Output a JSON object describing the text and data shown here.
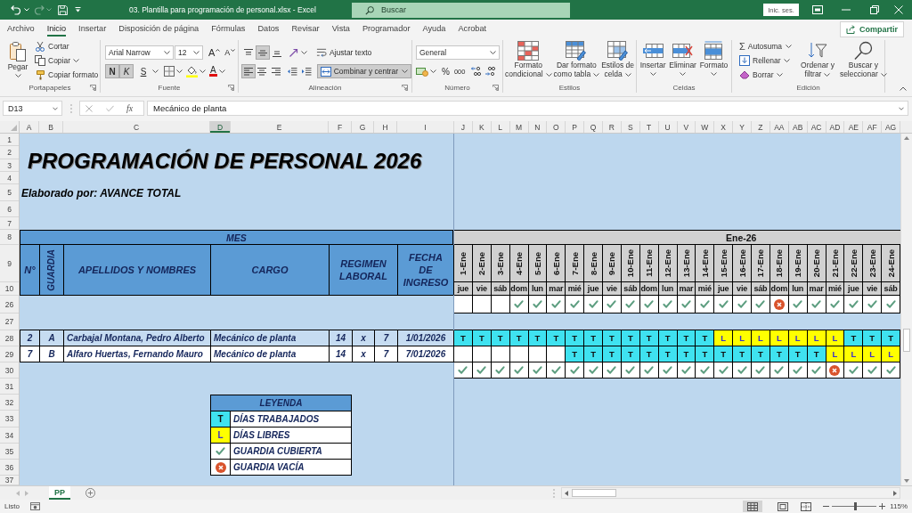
{
  "title_bar": {
    "quick_access": {
      "redo_disabled": true
    },
    "title": "03. Plantilla para programación de personal.xlsx - Excel",
    "search": {
      "placeholder": "Buscar"
    },
    "sign_in": "Inic. ses."
  },
  "ribbon_tabs": [
    {
      "label": "Archivo",
      "selected": false
    },
    {
      "label": "Inicio",
      "selected": true
    },
    {
      "label": "Insertar",
      "selected": false
    },
    {
      "label": "Disposición de página",
      "selected": false
    },
    {
      "label": "Fórmulas",
      "selected": false
    },
    {
      "label": "Datos",
      "selected": false
    },
    {
      "label": "Revisar",
      "selected": false
    },
    {
      "label": "Vista",
      "selected": false
    },
    {
      "label": "Programador",
      "selected": false
    },
    {
      "label": "Ayuda",
      "selected": false
    },
    {
      "label": "Acrobat",
      "selected": false
    }
  ],
  "share_button": "Compartir",
  "clipboard": {
    "paste": "Pegar",
    "cut": "Cortar",
    "copy": "Copiar",
    "format_painter": "Copiar formato",
    "label": "Portapapeles"
  },
  "font": {
    "name": "Arial Narrow",
    "size": "12",
    "grow": "A",
    "shrink": "A",
    "styles": [
      {
        "kind": "bold",
        "label": "N",
        "on": true
      },
      {
        "kind": "italic",
        "label": "K",
        "on": true
      },
      {
        "kind": "underline",
        "label": "S",
        "on": false
      }
    ],
    "color_letter": "A",
    "label": "Fuente"
  },
  "alignment": {
    "vertical": [
      {
        "kind": "top",
        "on": false
      },
      {
        "kind": "middle",
        "on": true
      },
      {
        "kind": "bottom",
        "on": false
      }
    ],
    "wrap_text": {
      "label": "Ajustar texto",
      "on": false
    },
    "horizontal": [
      {
        "kind": "left",
        "on": true
      },
      {
        "kind": "center",
        "on": false
      },
      {
        "kind": "right",
        "on": false
      }
    ],
    "merge": {
      "label": "Combinar y centrar",
      "on": true
    },
    "label": "Alineación"
  },
  "number": {
    "format": "General",
    "percent": "%",
    "thousands": "000",
    "label": "Número"
  },
  "styles": {
    "buttons": [
      {
        "kind": "conditional",
        "label": "Formato\ncondicional"
      },
      {
        "kind": "table",
        "label": "Dar formato\ncomo tabla"
      },
      {
        "kind": "cell_styles",
        "label": "Estilos de\ncelda"
      }
    ],
    "label": "Estilos"
  },
  "cells": {
    "buttons": [
      {
        "kind": "insert",
        "label": "Insertar"
      },
      {
        "kind": "delete",
        "label": "Eliminar"
      },
      {
        "kind": "format",
        "label": "Formato"
      }
    ],
    "label": "Celdas"
  },
  "editing": {
    "autosum_symbol": "Σ",
    "autosum": "Autosuma",
    "fill": "Rellenar",
    "clear": "Borrar",
    "sort": "Ordenar y\nfiltrar",
    "find": "Buscar y\nseleccionar",
    "label": "Edición"
  },
  "formula_bar": {
    "name_box": "D13",
    "function_button": "fx",
    "value": "Mecánico de planta"
  },
  "columns": [
    {
      "label": "A",
      "selected": false
    },
    {
      "label": "B",
      "selected": false
    },
    {
      "label": "C",
      "selected": false
    },
    {
      "label": "D",
      "selected": true
    },
    {
      "label": "E",
      "selected": false
    },
    {
      "label": "F",
      "selected": false
    },
    {
      "label": "G",
      "selected": false
    },
    {
      "label": "H",
      "selected": false
    },
    {
      "label": "I",
      "selected": false
    },
    {
      "label": "J",
      "selected": false
    },
    {
      "label": "K",
      "selected": false
    },
    {
      "label": "L",
      "selected": false
    },
    {
      "label": "M",
      "selected": false
    },
    {
      "label": "N",
      "selected": false
    },
    {
      "label": "O",
      "selected": false
    },
    {
      "label": "P",
      "selected": false
    },
    {
      "label": "Q",
      "selected": false
    },
    {
      "label": "R",
      "selected": false
    },
    {
      "label": "S",
      "selected": false
    },
    {
      "label": "T",
      "selected": false
    },
    {
      "label": "U",
      "selected": false
    },
    {
      "label": "V",
      "selected": false
    },
    {
      "label": "W",
      "selected": false
    },
    {
      "label": "X",
      "selected": false
    },
    {
      "label": "Y",
      "selected": false
    },
    {
      "label": "Z",
      "selected": false
    },
    {
      "label": "AA",
      "selected": false
    },
    {
      "label": "AB",
      "selected": false
    },
    {
      "label": "AC",
      "selected": false
    },
    {
      "label": "AD",
      "selected": false
    },
    {
      "label": "AE",
      "selected": false
    },
    {
      "label": "AF",
      "selected": false
    },
    {
      "label": "AG",
      "selected": false
    }
  ],
  "row_numbers": [
    "1",
    "2",
    "3",
    "4",
    "5",
    "6",
    "7",
    "8",
    "9",
    "10",
    "26",
    "27",
    "28",
    "29",
    "30",
    "31",
    "32",
    "33",
    "34",
    "35",
    "36",
    "37"
  ],
  "sheet": {
    "title": "PROGRAMACIÓN DE PERSONAL 2026",
    "subtitle": "Elaborado por: AVANCE TOTAL",
    "month_header": "MES",
    "period_header": "Ene-26",
    "headers": [
      {
        "kind": "number",
        "label": "N°"
      },
      {
        "kind": "guard",
        "label": "GUARDIA"
      },
      {
        "kind": "name",
        "label": "APELLIDOS Y NOMBRES"
      },
      {
        "kind": "position",
        "label": "CARGO"
      },
      {
        "kind": "regime",
        "label": "REGIMEN LABORAL"
      },
      {
        "kind": "start_date",
        "label": "FECHA DE INGRESO"
      }
    ],
    "days": [
      {
        "date": "1-Ene",
        "weekday": "jue"
      },
      {
        "date": "2-Ene",
        "weekday": "vie"
      },
      {
        "date": "3-Ene",
        "weekday": "sáb"
      },
      {
        "date": "4-Ene",
        "weekday": "dom"
      },
      {
        "date": "5-Ene",
        "weekday": "lun"
      },
      {
        "date": "6-Ene",
        "weekday": "mar"
      },
      {
        "date": "7-Ene",
        "weekday": "mié"
      },
      {
        "date": "8-Ene",
        "weekday": "jue"
      },
      {
        "date": "9-Ene",
        "weekday": "vie"
      },
      {
        "date": "10-Ene",
        "weekday": "sáb"
      },
      {
        "date": "11-Ene",
        "weekday": "dom"
      },
      {
        "date": "12-Ene",
        "weekday": "lun"
      },
      {
        "date": "13-Ene",
        "weekday": "mar"
      },
      {
        "date": "14-Ene",
        "weekday": "mié"
      },
      {
        "date": "15-Ene",
        "weekday": "jue"
      },
      {
        "date": "16-Ene",
        "weekday": "vie"
      },
      {
        "date": "17-Ene",
        "weekday": "sáb"
      },
      {
        "date": "18-Ene",
        "weekday": "dom"
      },
      {
        "date": "19-Ene",
        "weekday": "lun"
      },
      {
        "date": "20-Ene",
        "weekday": "mar"
      },
      {
        "date": "21-Ene",
        "weekday": "mié"
      },
      {
        "date": "22-Ene",
        "weekday": "jue"
      },
      {
        "date": "23-Ene",
        "weekday": "vie"
      },
      {
        "date": "24-Ene",
        "weekday": "sáb"
      }
    ],
    "coverage_upper": [
      {
        "kind": "none"
      },
      {
        "kind": "none"
      },
      {
        "kind": "none"
      },
      {
        "kind": "covered"
      },
      {
        "kind": "covered"
      },
      {
        "kind": "covered"
      },
      {
        "kind": "covered"
      },
      {
        "kind": "covered"
      },
      {
        "kind": "covered"
      },
      {
        "kind": "covered"
      },
      {
        "kind": "covered"
      },
      {
        "kind": "covered"
      },
      {
        "kind": "covered"
      },
      {
        "kind": "covered"
      },
      {
        "kind": "covered"
      },
      {
        "kind": "covered"
      },
      {
        "kind": "covered"
      },
      {
        "kind": "vacant"
      },
      {
        "kind": "covered"
      },
      {
        "kind": "covered"
      },
      {
        "kind": "covered"
      },
      {
        "kind": "covered"
      },
      {
        "kind": "covered"
      },
      {
        "kind": "covered"
      }
    ],
    "staff": [
      {
        "number": "2",
        "guard": "A",
        "name": "Carbajal Montana, Pedro Alberto",
        "position": "Mecánico de planta",
        "days_on": "14",
        "regime_separator": "x",
        "days_off": "7",
        "start_date": "1/01/2026",
        "color": "#c6dcf1",
        "shifts": [
          {
            "kind": "worked",
            "code": "T"
          },
          {
            "kind": "worked",
            "code": "T"
          },
          {
            "kind": "worked",
            "code": "T"
          },
          {
            "kind": "worked",
            "code": "T"
          },
          {
            "kind": "worked",
            "code": "T"
          },
          {
            "kind": "worked",
            "code": "T"
          },
          {
            "kind": "worked",
            "code": "T"
          },
          {
            "kind": "worked",
            "code": "T"
          },
          {
            "kind": "worked",
            "code": "T"
          },
          {
            "kind": "worked",
            "code": "T"
          },
          {
            "kind": "worked",
            "code": "T"
          },
          {
            "kind": "worked",
            "code": "T"
          },
          {
            "kind": "worked",
            "code": "T"
          },
          {
            "kind": "worked",
            "code": "T"
          },
          {
            "kind": "rest",
            "code": "L"
          },
          {
            "kind": "rest",
            "code": "L"
          },
          {
            "kind": "rest",
            "code": "L"
          },
          {
            "kind": "rest",
            "code": "L"
          },
          {
            "kind": "rest",
            "code": "L"
          },
          {
            "kind": "rest",
            "code": "L"
          },
          {
            "kind": "rest",
            "code": "L"
          },
          {
            "kind": "worked",
            "code": "T"
          },
          {
            "kind": "worked",
            "code": "T"
          },
          {
            "kind": "worked",
            "code": "T"
          }
        ]
      },
      {
        "number": "7",
        "guard": "B",
        "name": "Alfaro Huertas, Fernando Mauro",
        "position": "Mecánico de planta",
        "days_on": "14",
        "regime_separator": "x",
        "days_off": "7",
        "start_date": "7/01/2026",
        "color": "#ffffff",
        "shifts": [
          {
            "kind": "none"
          },
          {
            "kind": "none"
          },
          {
            "kind": "none"
          },
          {
            "kind": "none"
          },
          {
            "kind": "none"
          },
          {
            "kind": "none"
          },
          {
            "kind": "worked",
            "code": "T"
          },
          {
            "kind": "worked",
            "code": "T"
          },
          {
            "kind": "worked",
            "code": "T"
          },
          {
            "kind": "worked",
            "code": "T"
          },
          {
            "kind": "worked",
            "code": "T"
          },
          {
            "kind": "worked",
            "code": "T"
          },
          {
            "kind": "worked",
            "code": "T"
          },
          {
            "kind": "worked",
            "code": "T"
          },
          {
            "kind": "worked",
            "code": "T"
          },
          {
            "kind": "worked",
            "code": "T"
          },
          {
            "kind": "worked",
            "code": "T"
          },
          {
            "kind": "worked",
            "code": "T"
          },
          {
            "kind": "worked",
            "code": "T"
          },
          {
            "kind": "worked",
            "code": "T"
          },
          {
            "kind": "rest",
            "code": "L"
          },
          {
            "kind": "rest",
            "code": "L"
          },
          {
            "kind": "rest",
            "code": "L"
          },
          {
            "kind": "rest",
            "code": "L"
          }
        ]
      }
    ],
    "coverage_lower": [
      {
        "kind": "covered"
      },
      {
        "kind": "covered"
      },
      {
        "kind": "covered"
      },
      {
        "kind": "covered"
      },
      {
        "kind": "covered"
      },
      {
        "kind": "covered"
      },
      {
        "kind": "covered"
      },
      {
        "kind": "covered"
      },
      {
        "kind": "covered"
      },
      {
        "kind": "covered"
      },
      {
        "kind": "covered"
      },
      {
        "kind": "covered"
      },
      {
        "kind": "covered"
      },
      {
        "kind": "covered"
      },
      {
        "kind": "covered"
      },
      {
        "kind": "covered"
      },
      {
        "kind": "covered"
      },
      {
        "kind": "covered"
      },
      {
        "kind": "covered"
      },
      {
        "kind": "covered"
      },
      {
        "kind": "vacant"
      },
      {
        "kind": "covered"
      },
      {
        "kind": "covered"
      },
      {
        "kind": "covered"
      }
    ],
    "legend": {
      "title": "LEYENDA",
      "items": [
        {
          "kind": "worked",
          "code": "T",
          "label": "DÍAS TRABAJADOS"
        },
        {
          "kind": "rest",
          "code": "L",
          "label": "DÍAS LIBRES"
        },
        {
          "kind": "covered",
          "label": "GUARDIA CUBIERTA"
        },
        {
          "kind": "vacant",
          "label": "GUARDIA VACÍA"
        }
      ]
    }
  },
  "sheet_tabs": [
    {
      "label": "PP",
      "selected": true
    }
  ],
  "status_bar": {
    "status": "Listo",
    "views": [
      {
        "kind": "normal",
        "selected": true
      },
      {
        "kind": "page_layout",
        "selected": false
      },
      {
        "kind": "page_break",
        "selected": false
      }
    ],
    "zoom": {
      "level": 0.53,
      "reading": "115%"
    }
  }
}
